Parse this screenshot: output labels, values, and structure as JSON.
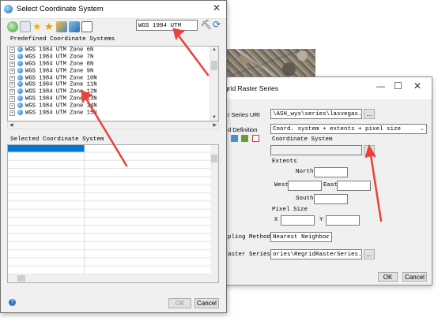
{
  "front_dialog": {
    "title": "Select Coordinate System",
    "search_value": "WGS 1984 UTM",
    "predefined_label": "Predefined Coordinate Systems",
    "tree_items": [
      "WGS 1984 UTM Zone  6N",
      "WGS 1984 UTM Zone  7N",
      "WGS 1984 UTM Zone  8N",
      "WGS 1984 UTM Zone  9N",
      "WGS 1984 UTM Zone 10N",
      "WGS 1984 UTM Zone 11N",
      "WGS 1984 UTM Zone 12N",
      "WGS 1984 UTM Zone 13N",
      "WGS 1984 UTM Zone 14N",
      "WGS 1984 UTM Zone 15N"
    ],
    "selected_label": "Selected Coordinate System",
    "ok_label": "OK",
    "cancel_label": "Cancel",
    "help_glyph": "?"
  },
  "back_dialog": {
    "title": "grid Raster Series",
    "series_uri_label": "r Series URI",
    "series_uri_value": "\\ASH_wys\\series\\lasvegas.series",
    "grid_definition_label": "d Definition",
    "grid_definition_value": "Coord. system + extents + pixel size",
    "coord_system_label": "Coordinate System",
    "extents_label": "Extents",
    "north_label": "North",
    "west_label": "West",
    "east_label": "East",
    "south_label": "South",
    "pixel_size_label": "Pixel Size",
    "x_label": "X",
    "y_label": "Y",
    "resampling_label": "pling Method",
    "resampling_value": "Nearest Neighbor",
    "raster_series_label": "aster Series",
    "raster_series_value": "ories\\RegridRasterSeries.series",
    "browse_label": "...",
    "ok_label": "OK",
    "cancel_label": "Cancel"
  },
  "colors": {
    "annotation_red": "#e8413b",
    "selection_blue": "#0078d7",
    "title_bg": "#ffffff",
    "dialog_bg": "#f0f0f0"
  }
}
